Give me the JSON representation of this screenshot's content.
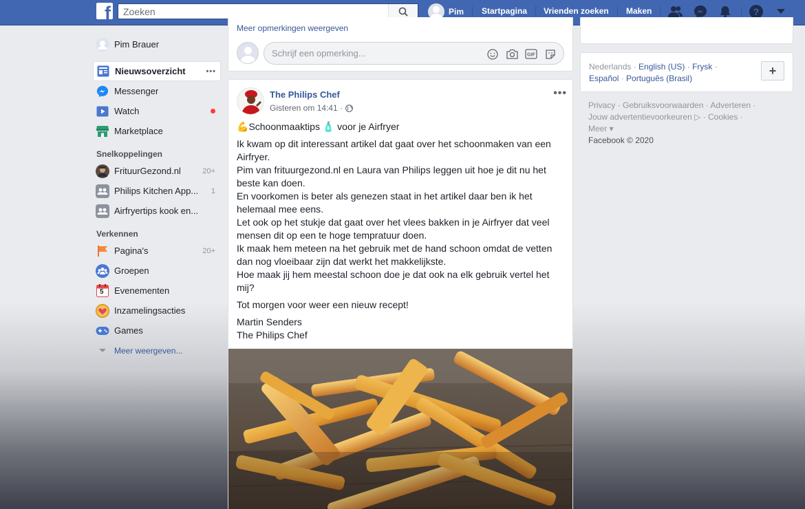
{
  "topbar": {
    "logo": "f",
    "search_placeholder": "Zoeken",
    "user_name": "Pim",
    "links": [
      "Startpagina",
      "Vrienden zoeken",
      "Maken"
    ]
  },
  "sidebar": {
    "profile": "Pim Brauer",
    "main_items": [
      {
        "label": "Nieuwsoverzicht",
        "icon": "news-feed-icon",
        "active": true,
        "more": "•••"
      },
      {
        "label": "Messenger",
        "icon": "messenger-icon"
      },
      {
        "label": "Watch",
        "icon": "watch-icon",
        "dot": true
      },
      {
        "label": "Marketplace",
        "icon": "marketplace-icon"
      }
    ],
    "shortcuts_title": "Snelkoppelingen",
    "shortcuts": [
      {
        "label": "FrituurGezond.nl",
        "count": "20+"
      },
      {
        "label": "Philips Kitchen App...",
        "count": "1"
      },
      {
        "label": "Airfryertips kook en...",
        "count": ""
      }
    ],
    "explore_title": "Verkennen",
    "explore": [
      {
        "label": "Pagina's",
        "count": "20+",
        "icon": "pages-flag-icon"
      },
      {
        "label": "Groepen",
        "count": "",
        "icon": "groups-icon"
      },
      {
        "label": "Evenementen",
        "count": "",
        "icon": "events-calendar-icon",
        "badge": "5"
      },
      {
        "label": "Inzamelingsacties",
        "count": "",
        "icon": "fundraisers-icon"
      },
      {
        "label": "Games",
        "count": "",
        "icon": "games-icon"
      }
    ],
    "see_more": "Meer weergeven..."
  },
  "comment_box": {
    "more_comments": "Meer opmerkingen weergeven",
    "placeholder": "Schrijf een opmerking..."
  },
  "post": {
    "author": "The Philips Chef",
    "timestamp": "Gisteren om 14:41 ·",
    "more": "•••",
    "title_emoji_1": "💪",
    "title_text_1": "Schoonmaaktips",
    "title_emoji_2": "🧴",
    "title_text_2": "voor je Airfryer",
    "paragraph": "Ik kwam op dit interessant artikel dat gaat over het schoonmaken van een Airfryer.\nPim van frituurgezond.nl en Laura van Philips leggen uit hoe je dit nu het beste kan doen.\nEn voorkomen is beter als genezen staat in het artikel daar ben ik het helemaal mee eens.\nLet ook op het stukje dat gaat over het vlees bakken in je Airfryer dat veel mensen dit op een te hoge tempratuur doen.\nIk maak hem meteen na het gebruik met de hand schoon omdat de vetten dan nog vloeibaar zijn dat werkt het makkelijkste.\nHoe maak jij hem meestal schoon doe je dat ook na elk gebruik vertel het mij?",
    "closing": "Tot morgen voor weer een nieuw recept!",
    "signature_1": "Martin Senders",
    "signature_2": "The Philips Chef"
  },
  "right": {
    "languages_line1": {
      "current": "Nederlands",
      "sep": " · ",
      "opt1": "English (US)",
      "opt2": "Frysk"
    },
    "languages_line2": {
      "opt3": "Español",
      "opt4": "Português (Brasil)"
    },
    "add_language": "+",
    "footer_line1": "Privacy · Gebruiksvoorwaarden · Adverteren ·",
    "footer_line2": "Jouw advertentievoorkeuren ▷ · Cookies ·",
    "footer_line3": "Meer ▾",
    "copyright": "Facebook © 2020"
  },
  "colors": {
    "brand": "#4267b2",
    "link": "#365899",
    "notification_dot": "#fa3e3e"
  }
}
